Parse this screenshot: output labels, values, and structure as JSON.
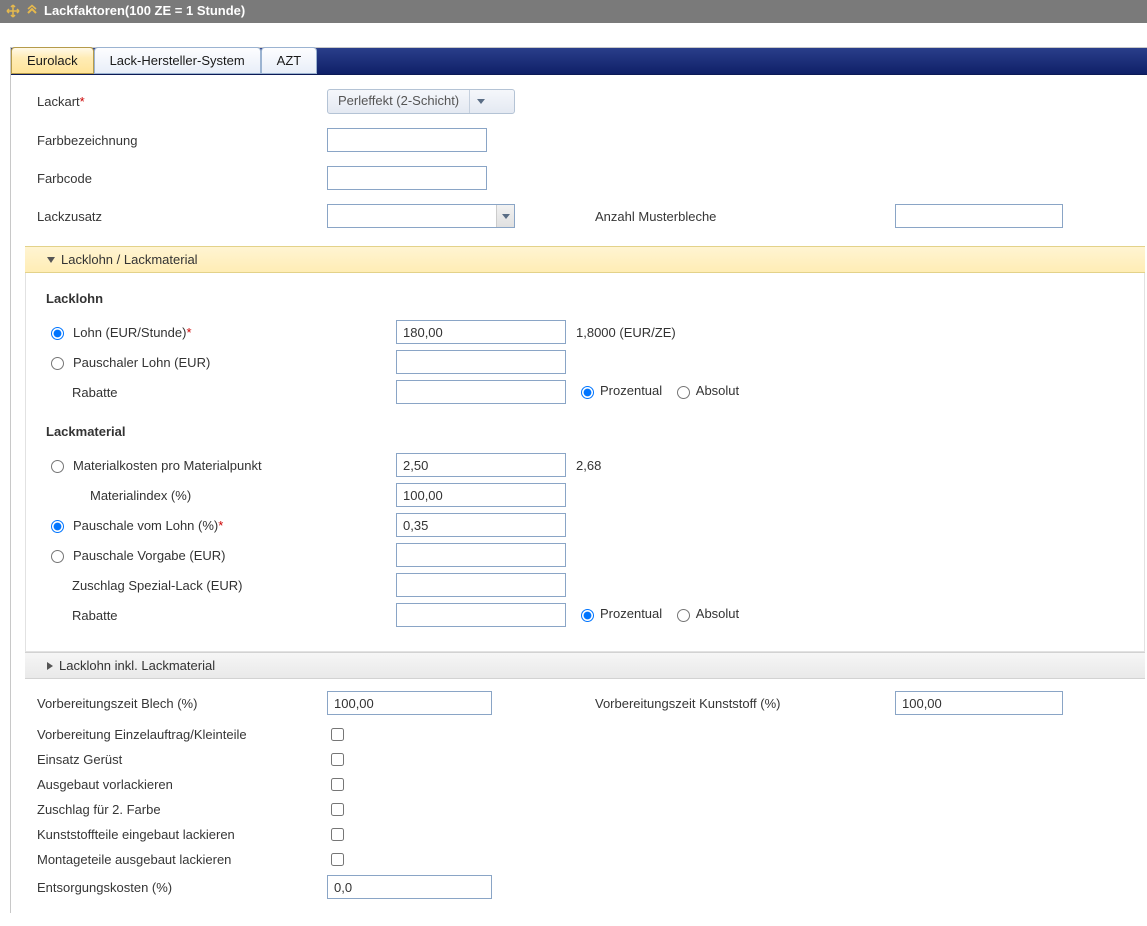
{
  "section_title": "Lackfaktoren(100 ZE = 1 Stunde)",
  "tabs": [
    "Eurolack",
    "Lack-Hersteller-System",
    "AZT"
  ],
  "top": {
    "lackart_label": "Lackart",
    "lackart_value": "Perleffekt (2-Schicht)",
    "farbbezeichnung_label": "Farbbezeichnung",
    "farbcode_label": "Farbcode",
    "lackzusatz_label": "Lackzusatz",
    "anzahl_musterbleche_label": "Anzahl Musterbleche"
  },
  "acc1_title": "Lacklohn / Lackmaterial",
  "lacklohn_heading": "Lacklohn",
  "lohn_label": "Lohn (EUR/Stunde)",
  "lohn_value": "180,00",
  "lohn_info": "1,8000 (EUR/ZE)",
  "pauschaler_lohn_label": "Pauschaler Lohn (EUR)",
  "rabatte_label": "Rabatte",
  "prozentual_label": "Prozentual",
  "absolut_label": "Absolut",
  "lackmaterial_heading": "Lackmaterial",
  "materialkosten_label": "Materialkosten pro Materialpunkt",
  "materialkosten_value": "2,50",
  "materialkosten_info": "2,68",
  "materialindex_label": "Materialindex (%)",
  "materialindex_value": "100,00",
  "pauschale_lohn_label": "Pauschale vom Lohn (%)",
  "pauschale_lohn_value": "0,35",
  "pauschale_vorgabe_label": "Pauschale Vorgabe (EUR)",
  "zuschlag_spezial_label": "Zuschlag Spezial-Lack (EUR)",
  "acc2_title": "Lacklohn inkl. Lackmaterial",
  "bottom": {
    "blech_label": "Vorbereitungszeit Blech (%)",
    "blech_value": "100,00",
    "kunststoff_label": "Vorbereitungszeit Kunststoff (%)",
    "kunststoff_value": "100,00",
    "einzel_label": "Vorbereitung Einzelauftrag/Kleinteile",
    "geruest_label": "Einsatz Gerüst",
    "ausgebaut_label": "Ausgebaut vorlackieren",
    "zweite_farbe_label": "Zuschlag für 2. Farbe",
    "kunststoffteile_label": "Kunststoffteile eingebaut lackieren",
    "montageteile_label": "Montageteile ausgebaut lackieren",
    "entsorgung_label": "Entsorgungskosten (%)",
    "entsorgung_value": "0,0"
  }
}
